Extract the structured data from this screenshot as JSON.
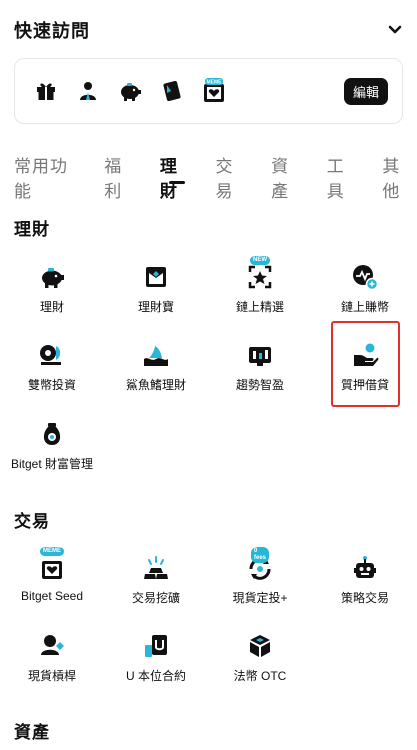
{
  "header": {
    "title": "快速訪問",
    "chevron_icon": "chevron-down-icon"
  },
  "quick_access": {
    "icons": [
      "gift-icon",
      "advisor-icon",
      "piggy-bank-icon",
      "tablet-icon",
      "meme-icon"
    ],
    "meme_badge": "MEME",
    "edit_label": "編輯"
  },
  "tabs": [
    {
      "label": "常用功能",
      "active": false
    },
    {
      "label": "福利",
      "active": false
    },
    {
      "label": "理財",
      "active": true
    },
    {
      "label": "交易",
      "active": false
    },
    {
      "label": "資產",
      "active": false
    },
    {
      "label": "工具",
      "active": false
    },
    {
      "label": "其他",
      "active": false
    }
  ],
  "sections": {
    "wealth": {
      "title": "理財",
      "items": [
        {
          "label": "理財",
          "icon": "piggy-bank-icon"
        },
        {
          "label": "理財寶",
          "icon": "treasure-icon"
        },
        {
          "label": "鏈上精選",
          "icon": "star-frame-icon",
          "badge": "NEW"
        },
        {
          "label": "鏈上賺幣",
          "icon": "chain-earn-icon"
        },
        {
          "label": "雙幣投資",
          "icon": "dual-coin-icon"
        },
        {
          "label": "鯊魚鰭理財",
          "icon": "shark-fin-icon"
        },
        {
          "label": "趨勢智盈",
          "icon": "trend-icon"
        },
        {
          "label": "質押借貸",
          "icon": "pledge-loan-icon"
        },
        {
          "label": "Bitget 財富管理",
          "icon": "money-bag-icon"
        }
      ]
    },
    "trade": {
      "title": "交易",
      "items": [
        {
          "label": "Bitget Seed",
          "icon": "meme-seed-icon",
          "badge": "MEME"
        },
        {
          "label": "交易挖礦",
          "icon": "gold-bars-icon"
        },
        {
          "label": "現貨定投+",
          "icon": "recurring-icon",
          "badge": "0 fees"
        },
        {
          "label": "策略交易",
          "icon": "robot-icon"
        },
        {
          "label": "現貨槓桿",
          "icon": "spot-margin-icon"
        },
        {
          "label": "U 本位合約",
          "icon": "usdt-futures-icon"
        },
        {
          "label": "法幣 OTC",
          "icon": "cube-icon"
        }
      ]
    },
    "assets": {
      "title": "資產"
    }
  },
  "colors": {
    "accent": "#2ab6d6",
    "highlight": "#e0302a",
    "text": "#111111",
    "muted": "#777777"
  }
}
